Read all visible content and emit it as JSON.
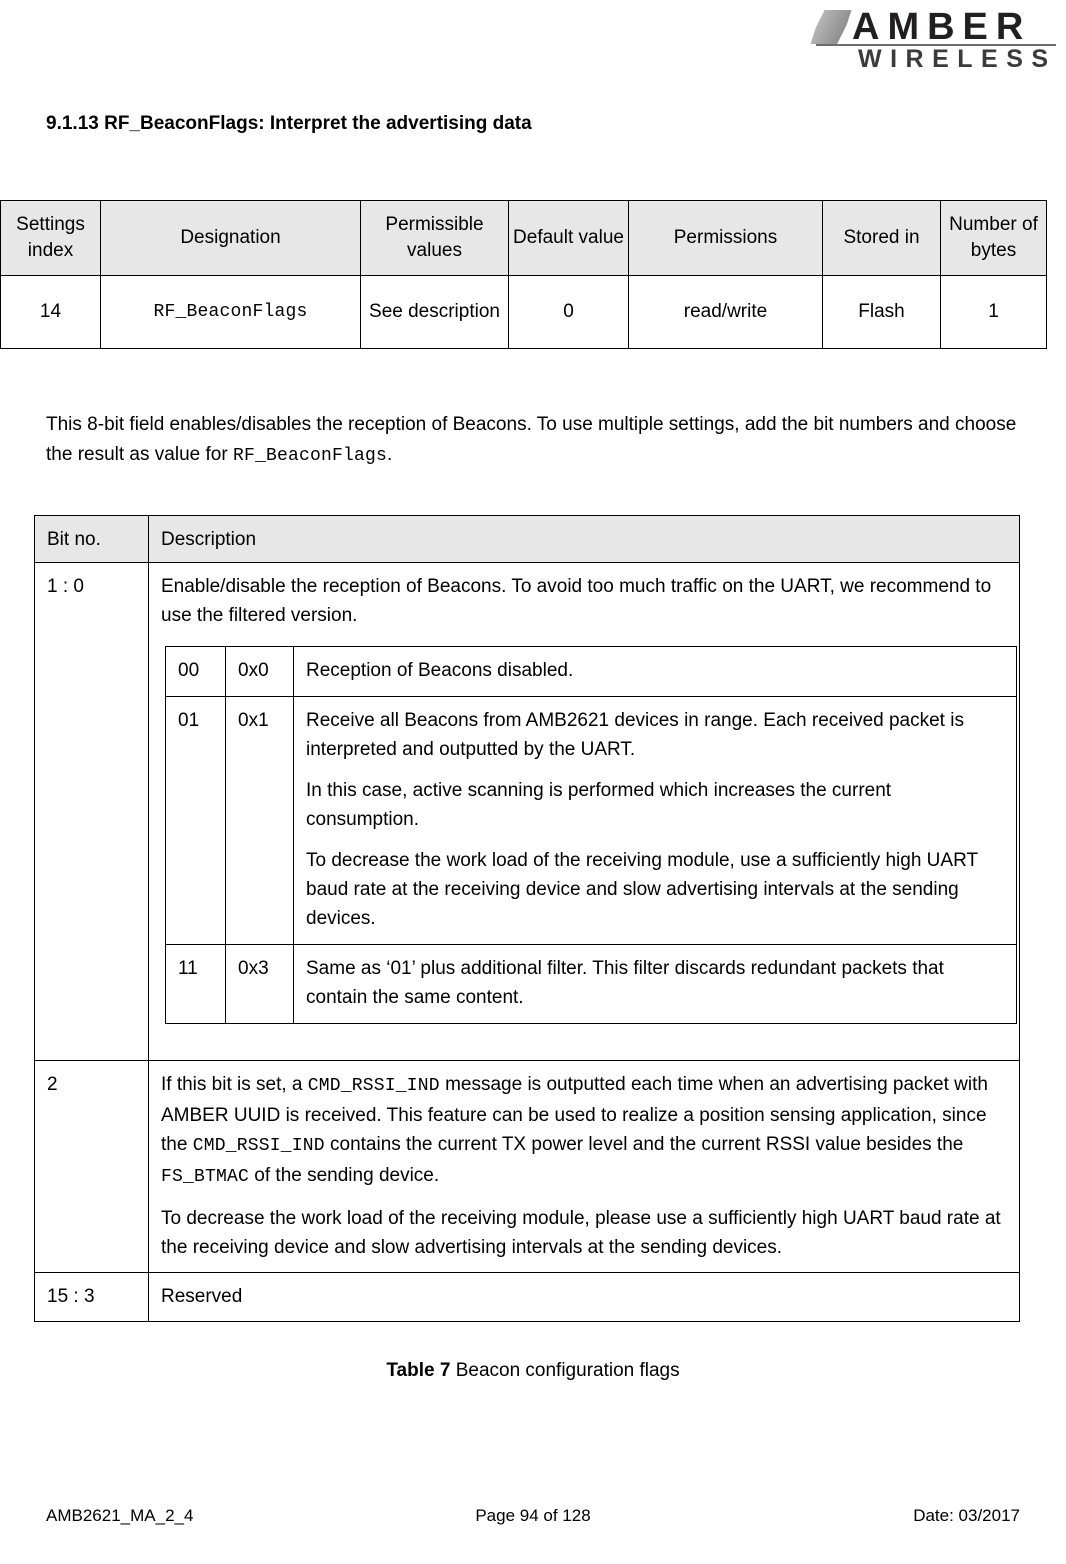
{
  "header": {
    "logo_primary": "AMBER",
    "logo_secondary": "WIRELESS"
  },
  "section": {
    "heading": "9.1.13 RF_BeaconFlags: Interpret the advertising data"
  },
  "settings_table": {
    "columns": [
      "Settings index",
      "Designation",
      "Permissible values",
      "Default value",
      "Permissions",
      "Stored in",
      "Number of bytes"
    ],
    "row": {
      "settings_index": "14",
      "designation": "RF_BeaconFlags",
      "permissible_values": "See description",
      "default_value": "0",
      "permissions": "read/write",
      "stored_in": "Flash",
      "number_of_bytes": "1"
    }
  },
  "intro": {
    "part1": "This 8-bit field enables/disables the reception of Beacons. To use multiple settings, add the bit numbers and choose the result as value for ",
    "code": "RF_BeaconFlags",
    "part2": "."
  },
  "bits_table": {
    "columns": [
      "Bit no.",
      "Description"
    ],
    "rows": {
      "row1": {
        "bit_no": "1 : 0",
        "description": "Enable/disable the reception of Beacons. To avoid too much traffic on the UART, we recommend to use the filtered version.",
        "sub_rows": [
          {
            "binary": "00",
            "hex": "0x0",
            "paragraphs": [
              "Reception of Beacons disabled."
            ]
          },
          {
            "binary": "01",
            "hex": "0x1",
            "paragraphs": [
              "Receive all Beacons from AMB2621 devices in range. Each received packet is interpreted and outputted by the UART.",
              "In this case, active scanning is performed which increases the current consumption.",
              "To decrease the work load of the receiving module, use a sufficiently high UART baud rate at the receiving device and slow advertising intervals at the sending devices."
            ]
          },
          {
            "binary": "11",
            "hex": "0x3",
            "paragraphs": [
              "Same as ‘01’ plus additional filter. This filter discards redundant packets that contain the same content."
            ]
          }
        ]
      },
      "row2": {
        "bit_no": "2",
        "p1_a": "If this bit is set, a ",
        "p1_code1": "CMD_RSSI_IND",
        "p1_b": " message is outputted each time when an advertising packet with AMBER UUID is received. This feature can be used to realize a position sensing application, since the ",
        "p1_code2": "CMD_RSSI_IND",
        "p1_c": " contains the current TX power level and the current RSSI value besides the ",
        "p1_code3": "FS_BTMAC",
        "p1_d": " of the sending device.",
        "p2": "To decrease the work load of the receiving module, please use a sufficiently high UART baud rate at the receiving device and slow advertising intervals at the sending devices."
      },
      "row3": {
        "bit_no": "15 : 3",
        "description": "Reserved"
      }
    }
  },
  "caption": {
    "label": "Table 7",
    "text": " Beacon configuration flags"
  },
  "footer": {
    "left": "AMB2621_MA_2_4",
    "center": "Page 94 of 128",
    "right": "Date: 03/2017"
  },
  "colors": {
    "table_header_bg": "#e7e7e7",
    "border": "#000000",
    "logo_dark": "#231f20",
    "logo_grey": "#6d6d6d"
  }
}
